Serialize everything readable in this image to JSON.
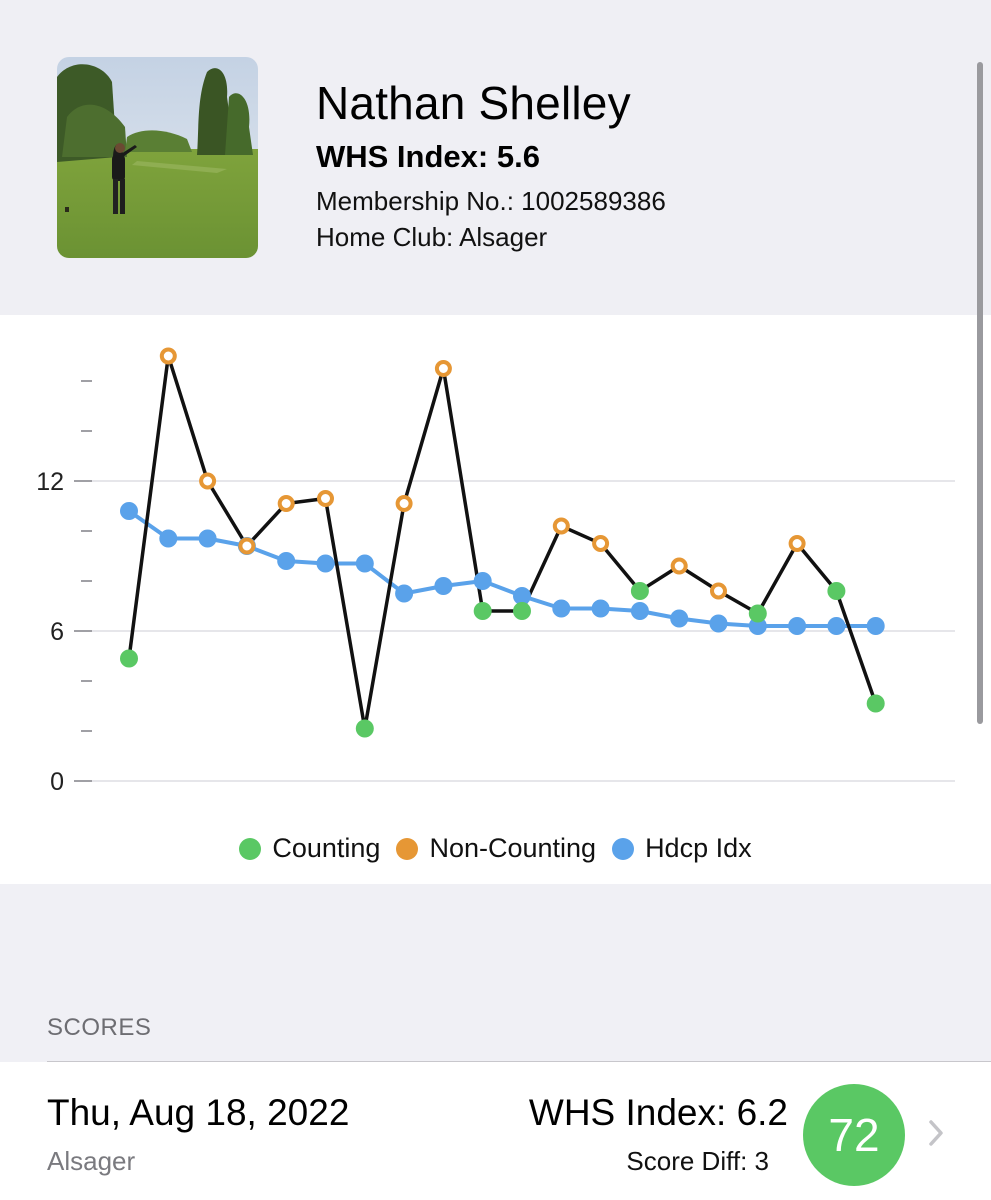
{
  "profile": {
    "name": "Nathan Shelley",
    "whs_index": "WHS Index: 5.6",
    "membership": "Membership No.: 1002589386",
    "home_club": "Home Club: Alsager"
  },
  "colors": {
    "counting": "#5ac864",
    "non_counting": "#e69735",
    "hdcp_idx": "#5aa2ea",
    "score_line": "#111111",
    "score_badge": "#5ac864"
  },
  "chart_data": {
    "type": "line",
    "ylim": [
      0,
      17.2
    ],
    "yticks": [
      0,
      6,
      12
    ],
    "grid": true,
    "legend": "bottom-center",
    "series": [
      {
        "name": "Counting",
        "role": "score",
        "points": [
          {
            "v": 4.9,
            "c": true
          },
          {
            "v": 17.0,
            "c": false
          },
          {
            "v": 12.0,
            "c": false
          },
          {
            "v": 9.4,
            "c": false
          },
          {
            "v": 11.1,
            "c": false
          },
          {
            "v": 11.3,
            "c": false
          },
          {
            "v": 2.1,
            "c": true
          },
          {
            "v": 11.1,
            "c": false
          },
          {
            "v": 16.5,
            "c": false
          },
          {
            "v": 6.8,
            "c": true
          },
          {
            "v": 6.8,
            "c": true
          },
          {
            "v": 10.2,
            "c": false
          },
          {
            "v": 9.5,
            "c": false
          },
          {
            "v": 7.6,
            "c": true
          },
          {
            "v": 8.6,
            "c": false
          },
          {
            "v": 7.6,
            "c": false
          },
          {
            "v": 6.7,
            "c": true
          },
          {
            "v": 9.5,
            "c": false
          },
          {
            "v": 7.6,
            "c": true
          },
          {
            "v": 3.1,
            "c": true
          }
        ]
      },
      {
        "name": "Hdcp Idx",
        "role": "index",
        "values": [
          10.8,
          9.7,
          9.7,
          9.4,
          8.8,
          8.7,
          8.7,
          7.5,
          7.8,
          8.0,
          7.4,
          6.9,
          6.9,
          6.8,
          6.5,
          6.3,
          6.2,
          6.2,
          6.2,
          6.2
        ]
      }
    ],
    "legend_labels": [
      "Counting",
      "Non-Counting",
      "Hdcp Idx"
    ]
  },
  "scores": {
    "header": "SCORES",
    "rows": [
      {
        "date": "Thu, Aug 18, 2022",
        "club": "Alsager",
        "whs_index": "WHS Index: 6.2",
        "score_diff": "Score Diff: 3",
        "score": "72"
      }
    ]
  },
  "icons": {
    "chevron": "chevron-right-icon",
    "avatar": "golfer-photo"
  }
}
